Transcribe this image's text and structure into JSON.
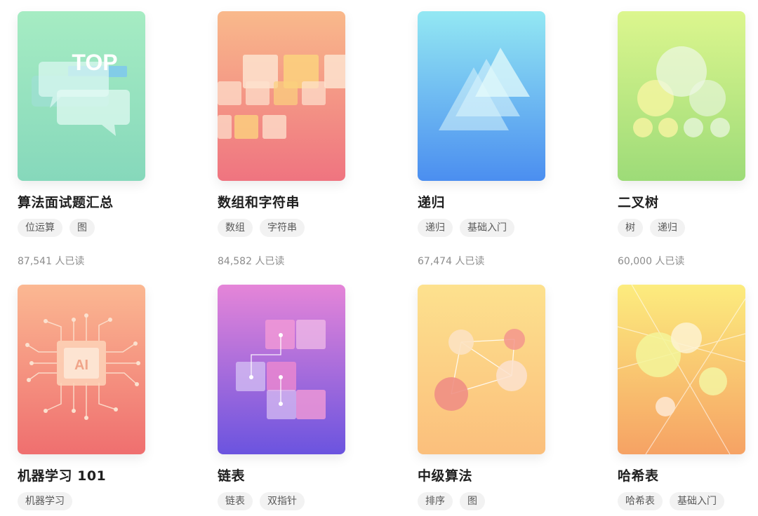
{
  "cards": [
    {
      "title": "算法面试题汇总",
      "tags": [
        "位运算",
        "图"
      ],
      "reads": "87,541 人已读",
      "cover_icon": "chat-bubbles-top-icon",
      "cover_text": "TOP",
      "gradient": [
        "#a6ecc3",
        "#8cd9b8"
      ]
    },
    {
      "title": "数组和字符串",
      "tags": [
        "数组",
        "字符串"
      ],
      "reads": "84,582 人已读",
      "cover_icon": "array-blocks-icon",
      "gradient": [
        "#f8b58a",
        "#f07a7e"
      ]
    },
    {
      "title": "递归",
      "tags": [
        "递归",
        "基础入门"
      ],
      "reads": "67,474 人已读",
      "cover_icon": "recursive-triangles-icon",
      "gradient": [
        "#8fe6f2",
        "#4f8ff0"
      ]
    },
    {
      "title": "二叉树",
      "tags": [
        "树",
        "递归"
      ],
      "reads": "60,000 人已读",
      "cover_icon": "binary-tree-icon",
      "gradient": [
        "#d8f58e",
        "#9edc78"
      ]
    },
    {
      "title": "机器学习 101",
      "tags": [
        "机器学习"
      ],
      "reads": "",
      "cover_icon": "ai-chip-icon",
      "cover_text": "AI",
      "gradient": [
        "#fbb690",
        "#f07070"
      ]
    },
    {
      "title": "链表",
      "tags": [
        "链表",
        "双指针"
      ],
      "reads": "",
      "cover_icon": "linked-list-icon",
      "gradient": [
        "#e882d6",
        "#6f55e0"
      ]
    },
    {
      "title": "中级算法",
      "tags": [
        "排序",
        "图"
      ],
      "reads": "",
      "cover_icon": "graph-nodes-icon",
      "gradient": [
        "#fde08c",
        "#fbc07c"
      ]
    },
    {
      "title": "哈希表",
      "tags": [
        "哈希表",
        "基础入门"
      ],
      "reads": "",
      "cover_icon": "hash-circles-icon",
      "gradient": [
        "#fcec7c",
        "#f7a463"
      ]
    }
  ]
}
